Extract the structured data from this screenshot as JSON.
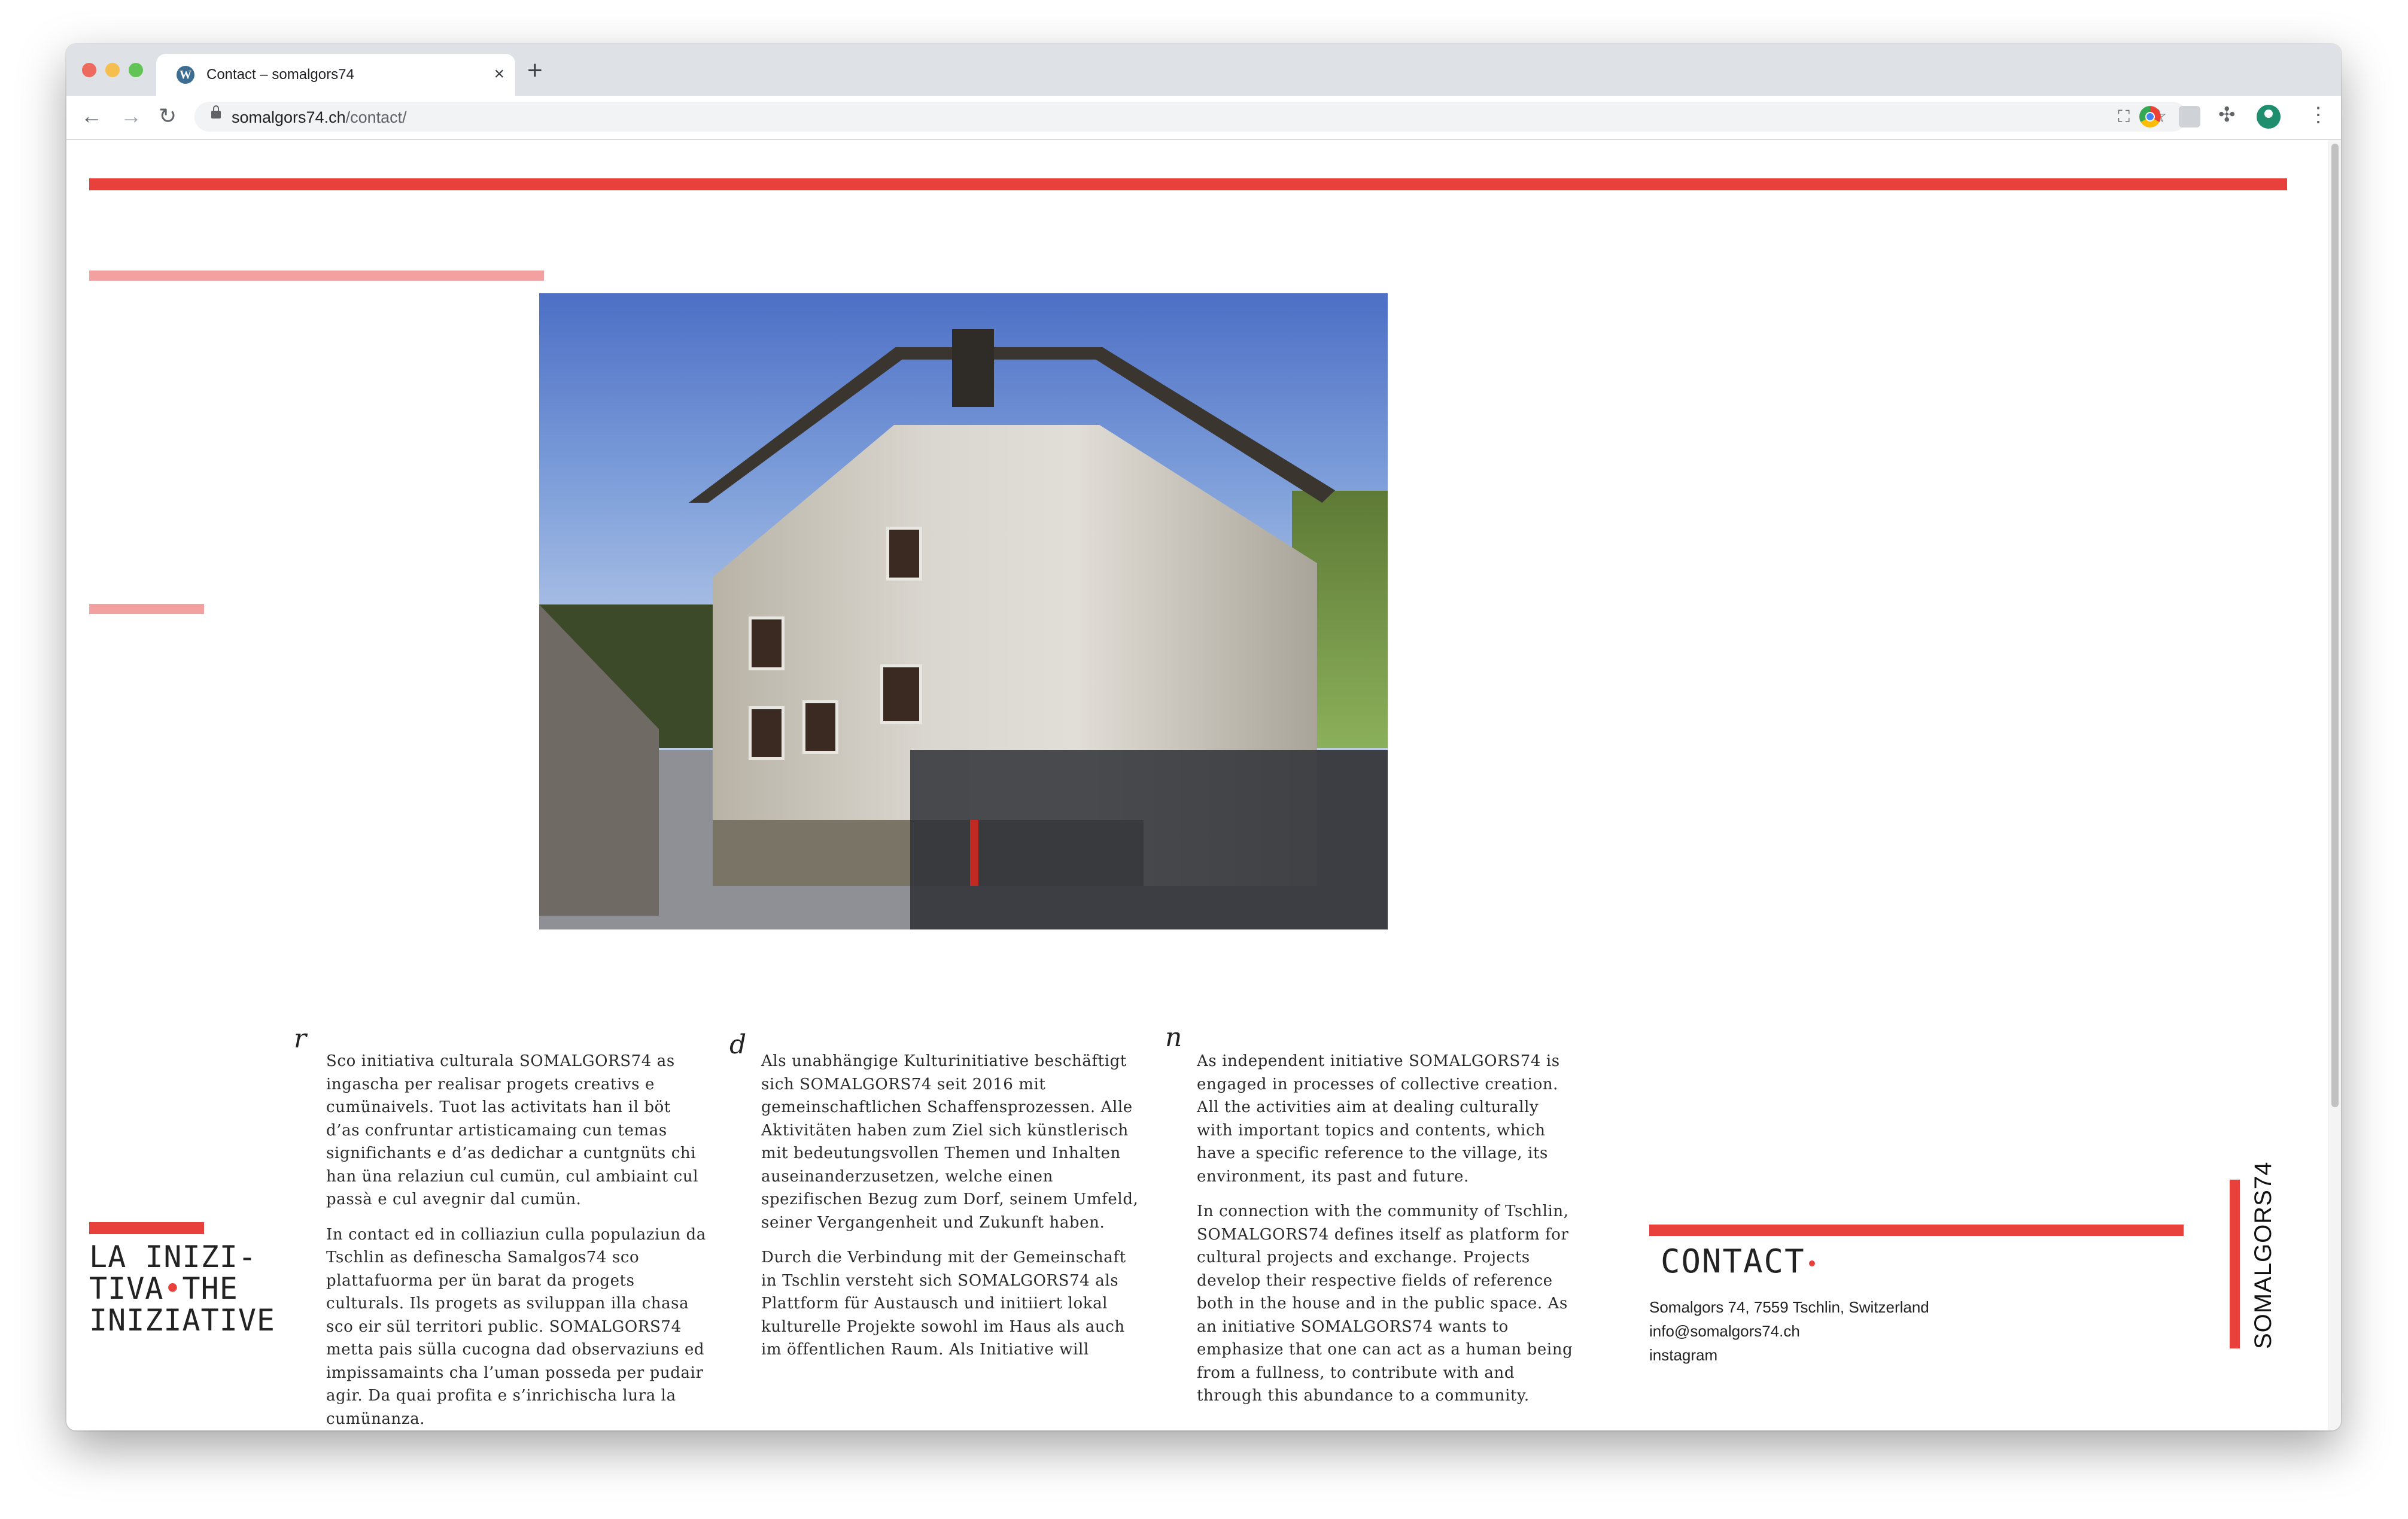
{
  "browser": {
    "tab_title": "Contact – somalgors74",
    "tab_close": "×",
    "new_tab": "+",
    "url_host": "somalgors74.ch",
    "url_path": "/contact/",
    "icons": [
      "back-arrow-icon",
      "forward-arrow-icon",
      "reload-icon",
      "lock-icon",
      "translate-icon",
      "star-icon",
      "chrome-extension-icon",
      "extension-icon",
      "puzzle-icon",
      "avatar",
      "menu-icon"
    ]
  },
  "colors": {
    "accent_red": "#e8403b",
    "accent_pink": "#f2a0a0"
  },
  "page": {
    "photo_alt": "Historic plastered house in Tschlin",
    "columns": [
      {
        "mark": "r",
        "paragraphs": [
          "Sco initiativa culturala SOMALGORS74 as ingascha per realisar progets creativs e cumünaivels. Tuot las activitats han il böt d’as confruntar artisticamaing cun temas significhants e d’as dedichar a cuntgnüts chi han üna relaziun cul cumün, cul ambiaint cul passà e cul avegnir dal cumün.",
          "In contact ed in colliaziun culla populaziun da Tschlin as definescha Samalgos74 sco plattafuorma per ün barat da progets culturals. Ils progets as sviluppan illa chasa sco eir sül territori public. SOMALGORS74 metta pais sülla cucogna dad observaziuns ed impissamaints cha l’uman posseda per pudair agir. Da quai profita e s’inrichischa lura la cumünanza."
        ]
      },
      {
        "mark": "d",
        "paragraphs": [
          "Als unabhängige Kulturinitiative beschäftigt sich SOMALGORS74 seit 2016 mit gemeinschaftlichen Schaffensprozessen. Alle Aktivitäten haben zum Ziel sich künstlerisch mit bedeutungsvollen Themen und Inhalten auseinanderzusetzen, welche einen spezifischen Bezug zum Dorf, seinem Umfeld, seiner Vergangenheit und Zukunft haben.",
          "Durch die Verbindung mit der Gemeinschaft in Tschlin versteht sich SOMALGORS74 als Plattform für Austausch und initiiert lokal kulturelle Projekte sowohl im Haus als auch im öffentlichen Raum. Als Initiative will"
        ]
      },
      {
        "mark": "n",
        "paragraphs": [
          "As independent initiative SOMALGORS74 is engaged in processes of collective creation. All the activities aim at dealing culturally with important topics and contents, which have a specific reference to the village, its environment, its past and future.",
          "In connection with the community of Tschlin, SOMALGORS74 defines itself as platform for cultural projects and exchange. Projects develop their respective fields of reference both in the house and in the public space. As an initiative SOMALGORS74 wants to emphasize that one can act as a human being from a fullness, to contribute with and through this abundance to a community."
        ]
      }
    ],
    "initiative_title": {
      "line1": "LA INIZI-",
      "line2a": "TIVA",
      "line2b": "THE",
      "line3": "INIZIATIVE"
    },
    "contact": {
      "title": "CONTACT",
      "address": "Somalgors 74, 7559 Tschlin, Switzerland",
      "email": "info@somalgors74.ch",
      "instagram": "instagram"
    },
    "side_brand": "SOMALGORS74"
  }
}
